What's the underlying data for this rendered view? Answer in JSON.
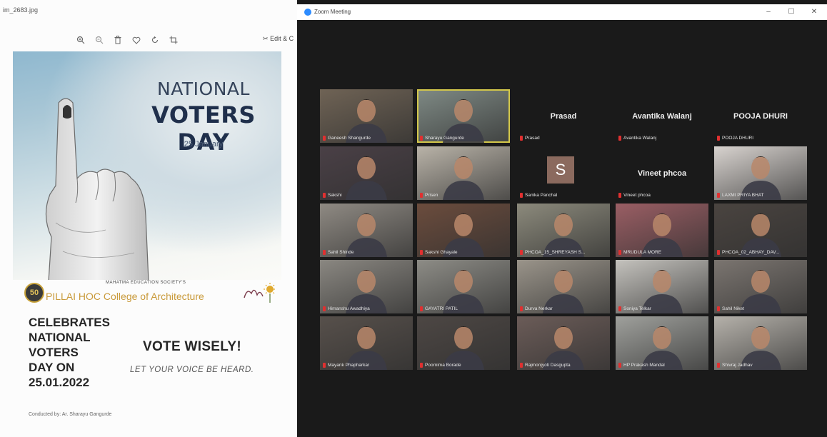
{
  "viewer": {
    "title": "im_2683.jpg",
    "toolbar_icons": [
      "zoom-in-icon",
      "zoom-out-icon",
      "delete-icon",
      "heart-icon",
      "rotate-icon",
      "crop-icon"
    ],
    "edit_label": "Edit & C",
    "poster": {
      "title_line1": "NATIONAL",
      "title_line2": "VOTERS DAY",
      "date": "25 January",
      "society": "MAHATMA EDUCATION SOCIETY'S",
      "badge": "50",
      "college": "PILLAI HOC College of Architecture",
      "celebrates": [
        "CELEBRATES",
        "NATIONAL",
        "VOTERS",
        "DAY ON",
        "25.01.2022"
      ],
      "slogan": "VOTE WISELY!",
      "tagline": "LET YOUR VOICE BE HEARD.",
      "conducted_by": "Conducted by: Ar. Sharayu Gangurde"
    }
  },
  "zoom": {
    "title": "Zoom Meeting",
    "controls": [
      "–",
      "☐",
      "✕"
    ],
    "participants": [
      {
        "label": "Ganeesh Shangurde",
        "type": "video",
        "bg": "#6f6355"
      },
      {
        "label": "Sharayu Gangurde",
        "type": "video",
        "bg": "#7f8a85",
        "highlight": true
      },
      {
        "label": "Prasad",
        "type": "name",
        "name": "Prasad"
      },
      {
        "label": "Avantika Walanj",
        "type": "name",
        "name": "Avantika Walanj"
      },
      {
        "label": "POOJA DHURI",
        "type": "name",
        "name": "POOJA DHURI"
      },
      {
        "label": "Sakshi",
        "type": "video",
        "bg": "#4a4046"
      },
      {
        "label": "Prisen",
        "type": "video",
        "bg": "#b9b3a8"
      },
      {
        "label": "Sanika Panchal",
        "type": "avatar",
        "initial": "S"
      },
      {
        "label": "Vineet phcoa",
        "type": "name",
        "name": "Vineet phcoa"
      },
      {
        "label": "LAXMI PRIYA BHAT",
        "type": "video",
        "bg": "#d8d3cf"
      },
      {
        "label": "Sahil Shinde",
        "type": "video",
        "bg": "#8f8a83"
      },
      {
        "label": "Sakshi Ghayale",
        "type": "video",
        "bg": "#6b4c3d"
      },
      {
        "label": "PHCOA_15_SHREYASH S...",
        "type": "video",
        "bg": "#8c8a7c"
      },
      {
        "label": "MRUDULA MORE",
        "type": "video",
        "bg": "#9a5e64"
      },
      {
        "label": "PHCOA_02_ABHAY_DAV...",
        "type": "video",
        "bg": "#4a4440"
      },
      {
        "label": "Himanshu Awadhiya",
        "type": "video",
        "bg": "#8a8781"
      },
      {
        "label": "GAYATRI PATIL",
        "type": "video",
        "bg": "#8d8c86"
      },
      {
        "label": "Durva Nerkar",
        "type": "video",
        "bg": "#9a948a"
      },
      {
        "label": "Soniya Telkar",
        "type": "video",
        "bg": "#c4c2bd"
      },
      {
        "label": "Sahil Niket",
        "type": "video",
        "bg": "#7b7570"
      },
      {
        "label": "Mayank Phapharkar",
        "type": "video",
        "bg": "#57504b"
      },
      {
        "label": "Poornima Borade",
        "type": "video",
        "bg": "#4d4744"
      },
      {
        "label": "Rajmonjyoti Dasgupta",
        "type": "video",
        "bg": "#6b5c58"
      },
      {
        "label": "HP Prakash Mandal",
        "type": "video",
        "bg": "#9fa09c"
      },
      {
        "label": "Shivraj Jadhav",
        "type": "video",
        "bg": "#b5b1aa"
      }
    ]
  }
}
